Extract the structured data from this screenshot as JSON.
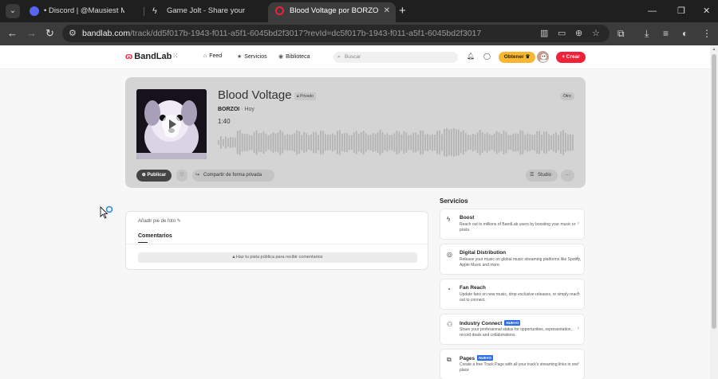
{
  "browser": {
    "tabs": [
      {
        "label": "• Discord | @Mausiest Mausy e",
        "favicon_color": "#5865f2"
      },
      {
        "label": "Game Jolt - Share your creation",
        "favicon_color": "#ccff00"
      },
      {
        "label": "Blood Voltage por BORZOI | Ba",
        "favicon_color": "#f0223a",
        "active": true
      }
    ],
    "new_tab": "+",
    "url_host": "bandlab.com",
    "url_path": "/track/dd5f017b-1943-f011-a5f1-6045bd2f3017?revId=dc5f017b-1943-f011-a5f1-6045bd2f3017"
  },
  "header": {
    "logo": "BandLab",
    "nav": [
      {
        "label": "Feed",
        "icon": "home-icon"
      },
      {
        "label": "Servicios",
        "icon": "star-icon"
      },
      {
        "label": "Biblioteca",
        "icon": "library-icon"
      }
    ],
    "search_placeholder": "Buscar",
    "obtener_label": "Obtener",
    "crear_label": "+ Crear"
  },
  "track": {
    "title": "Blood Voltage",
    "privacy": "Privado",
    "genre": "Otro",
    "artist": "BORZOI",
    "date": "Hoy",
    "duration": "1:40",
    "actions": {
      "publicar": "Publicar",
      "compartir": "Compartir de forma privada",
      "studio": "Studio",
      "more": "···"
    }
  },
  "comments": {
    "caption_label": "Añadir pie de foto",
    "tab_label": "Comentarios",
    "public_notice": "Haz tu pista pública para recibir comentarios"
  },
  "services": {
    "title": "Servicios",
    "items": [
      {
        "name": "Boost",
        "icon": "boost-icon",
        "badge": "",
        "desc": "Reach out to millions of BandLab users by boosting your music or posts."
      },
      {
        "name": "Digital Distribution",
        "icon": "distribution-icon",
        "badge": "",
        "desc": "Release your music on global music streaming platforms like Spotify, Apple Music and more."
      },
      {
        "name": "Fan Reach",
        "icon": "fan-reach-icon",
        "badge": "",
        "desc": "Update fans on new music, drop exclusive releases, or simply reach out to connect."
      },
      {
        "name": "Industry Connect",
        "icon": "industry-icon",
        "badge": "NUEVO",
        "desc": "Share your professional status for opportunities, representation, record deals and collaborations."
      },
      {
        "name": "Pages",
        "icon": "pages-icon",
        "badge": "NUEVO",
        "desc": "Create a free Track Page with all your track's streaming links in one place"
      }
    ]
  },
  "colors": {
    "brand": "#f0223a",
    "accent_yellow": "#f7b731",
    "link_blue": "#2b6de9",
    "track_card_bg": "#d4d4d4"
  }
}
